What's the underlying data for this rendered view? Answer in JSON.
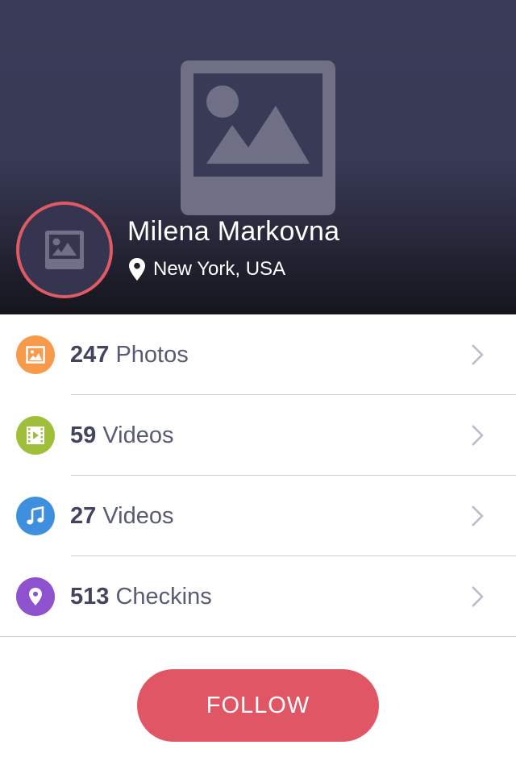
{
  "profile": {
    "name": "Milena Markovna",
    "location": "New York, USA"
  },
  "stats": [
    {
      "count": "247",
      "label": "Photos",
      "icon": "image-icon",
      "color": "#f79a4c"
    },
    {
      "count": "59",
      "label": "Videos",
      "icon": "film-icon",
      "color": "#9fbf3b"
    },
    {
      "count": "27",
      "label": "Videos",
      "icon": "music-note-icon",
      "color": "#3f8fdf"
    },
    {
      "count": "513",
      "label": "Checkins",
      "icon": "location-pin-icon",
      "color": "#8f52cf"
    }
  ],
  "follow": {
    "label": "FOLLOW"
  },
  "colors": {
    "accent": "#e05665",
    "header_top": "#3a3b58",
    "header_bottom": "#15151d",
    "text_dark": "#43455e",
    "chevron": "#b9bccc"
  }
}
